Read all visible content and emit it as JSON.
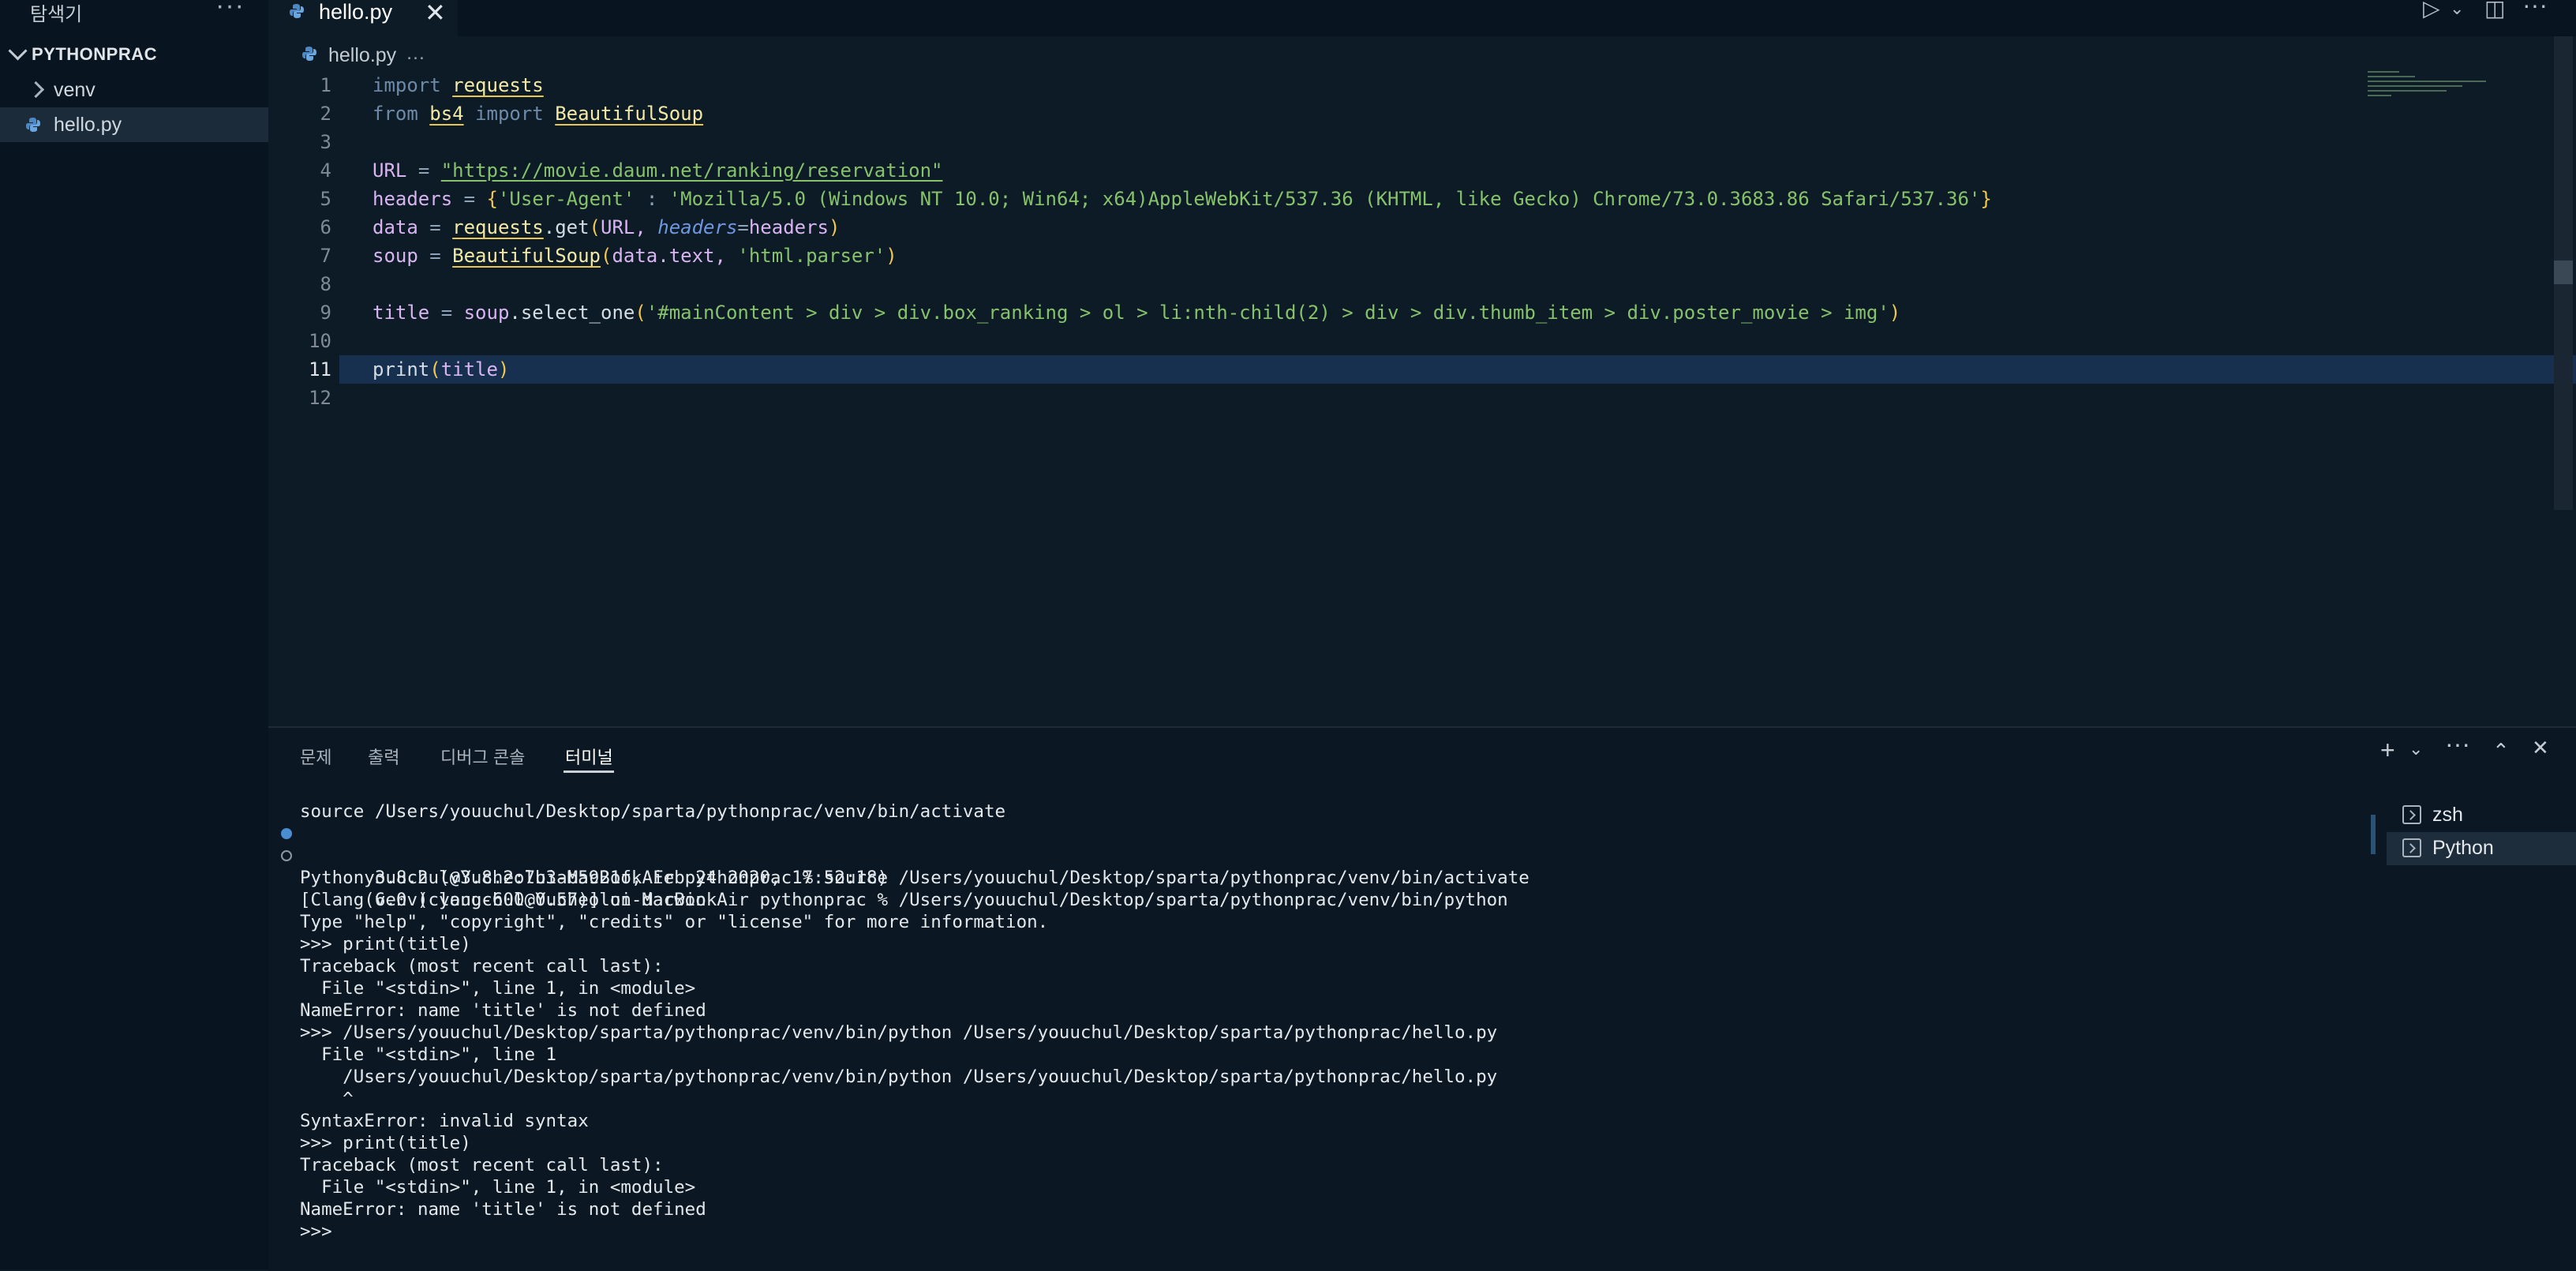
{
  "sidebar": {
    "title": "탐색기",
    "more": "···",
    "section": "PYTHONPRAC",
    "items": [
      {
        "label": "venv",
        "type": "folder"
      },
      {
        "label": "hello.py",
        "type": "python-file"
      }
    ]
  },
  "tabs": [
    {
      "label": "hello.py",
      "close": "✕"
    }
  ],
  "top_actions": {
    "run": "▷",
    "run_dropdown": "⌄",
    "split": "◫",
    "more": "···"
  },
  "breadcrumb": {
    "file": "hello.py",
    "sep": "…"
  },
  "editor": {
    "line_numbers": [
      "1",
      "2",
      "3",
      "4",
      "5",
      "6",
      "7",
      "8",
      "9",
      "10",
      "11",
      "12"
    ],
    "cursor_line": 11
  },
  "panel": {
    "tabs": [
      "문제",
      "출력",
      "디버그 콘솔",
      "터미널"
    ],
    "active_tab": "터미널",
    "actions": {
      "add": "+",
      "add_dropdown": "⌄",
      "more": "···",
      "maximize": "⌃",
      "close": "✕"
    },
    "terminal_lines": [
      "source /Users/youuchul/Desktop/sparta/pythonprac/venv/bin/activate",
      "youuchul@Yucheolui-MacBookAir pythonprac % source /Users/youuchul/Desktop/sparta/pythonprac/venv/bin/activate",
      "(venv) youuchul@Yucheolui-MacBookAir pythonprac % /Users/youuchul/Desktop/sparta/pythonprac/venv/bin/python",
      "Python 3.8.2 (v3.8.2:7b3ab5921f, Feb 24 2020, 17:52:18)",
      "[Clang 6.0 (clang-600.0.57)] on darwin",
      "Type \"help\", \"copyright\", \"credits\" or \"license\" for more information.",
      ">>> print(title)",
      "Traceback (most recent call last):",
      "  File \"<stdin>\", line 1, in <module>",
      "NameError: name 'title' is not defined",
      ">>> /Users/youuchul/Desktop/sparta/pythonprac/venv/bin/python /Users/youuchul/Desktop/sparta/pythonprac/hello.py",
      "  File \"<stdin>\", line 1",
      "    /Users/youuchul/Desktop/sparta/pythonprac/venv/bin/python /Users/youuchul/Desktop/sparta/pythonprac/hello.py",
      "    ^",
      "SyntaxError: invalid syntax",
      ">>> print(title)",
      "Traceback (most recent call last):",
      "  File \"<stdin>\", line 1, in <module>",
      "NameError: name 'title' is not defined",
      ">>> "
    ],
    "terminal_list": [
      {
        "label": "zsh"
      },
      {
        "label": "Python"
      }
    ]
  },
  "code": {
    "l1_kw": "import",
    "l1_mod": "requests",
    "l2_kw": "from",
    "l2_mod": "bs4",
    "l2_kw2": "import",
    "l2_cls": "BeautifulSoup",
    "l4_var": "URL",
    "l4_op": "=",
    "l4_str": "\"https://movie.daum.net/ranking/reservation\"",
    "l5_var": "headers",
    "l5_op": "=",
    "l5_b1": "{",
    "l5_key": "'User-Agent'",
    "l5_colon": ":",
    "l5_val": "'Mozilla/5.0 (Windows NT 10.0; Win64; x64)AppleWebKit/537.36 (KHTML, like Gecko) Chrome/73.0.3683.86 Safari/537.36'",
    "l5_b2": "}",
    "l6_var": "data",
    "l6_op": "=",
    "l6_mod": "requests",
    "l6_fn": ".get",
    "l6_b1": "(",
    "l6_arg": "URL, ",
    "l6_param": "headers",
    "l6_eq": "=",
    "l6_val": "headers",
    "l6_b2": ")",
    "l7_var": "soup",
    "l7_op": "=",
    "l7_cls": "BeautifulSoup",
    "l7_b1": "(",
    "l7_arg": "data.text, ",
    "l7_str": "'html.parser'",
    "l7_b2": ")",
    "l9_var": "title",
    "l9_op": "=",
    "l9_obj": "soup",
    "l9_fn": ".select_one",
    "l9_b1": "(",
    "l9_str": "'#mainContent > div > div.box_ranking > ol > li:nth-child(2) > div > div.thumb_item > div.poster_movie > img'",
    "l9_b2": ")",
    "l11_fn": "print",
    "l11_b1": "(",
    "l11_arg": "title",
    "l11_b2": ")"
  }
}
